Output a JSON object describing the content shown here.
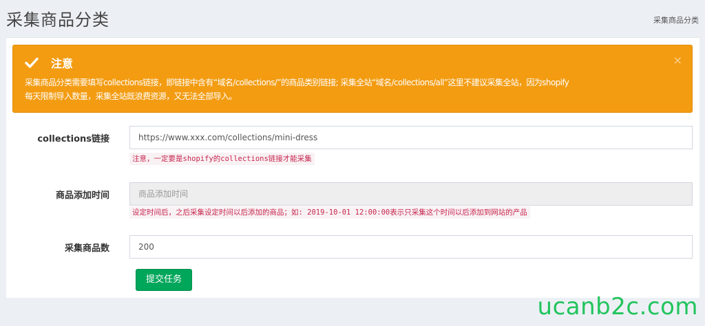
{
  "header": {
    "title": "采集商品分类",
    "breadcrumb": "采集商品分类"
  },
  "alert": {
    "title": "注意",
    "close": "×",
    "message_line1": "采集商品分类需要填写collections链接，即链接中含有“域名/collections/”的商品类别链接; 采集全站“域名/collections/all”这里不建议采集全站，因为shopify",
    "message_line2": "每天限制导入数量，采集全站既浪费资源，又无法全部导入。",
    "color": "#f39c12"
  },
  "form": {
    "collections": {
      "label": "collections链接",
      "value": "https://www.xxx.com/collections/mini-dress",
      "help": "注意，一定要是shopify的collections链接才能采集"
    },
    "add_time": {
      "label": "商品添加时间",
      "placeholder": "商品添加时间",
      "help": "设定时间后，之后采集设定时间以后添加的商品；如: 2019-10-01 12:00:00表示只采集这个时间以后添加到网站的产品"
    },
    "count": {
      "label": "采集商品数",
      "value": "200"
    },
    "submit_label": "提交任务",
    "submit_color": "#00a65a"
  },
  "watermark": "ucanb2c.com"
}
